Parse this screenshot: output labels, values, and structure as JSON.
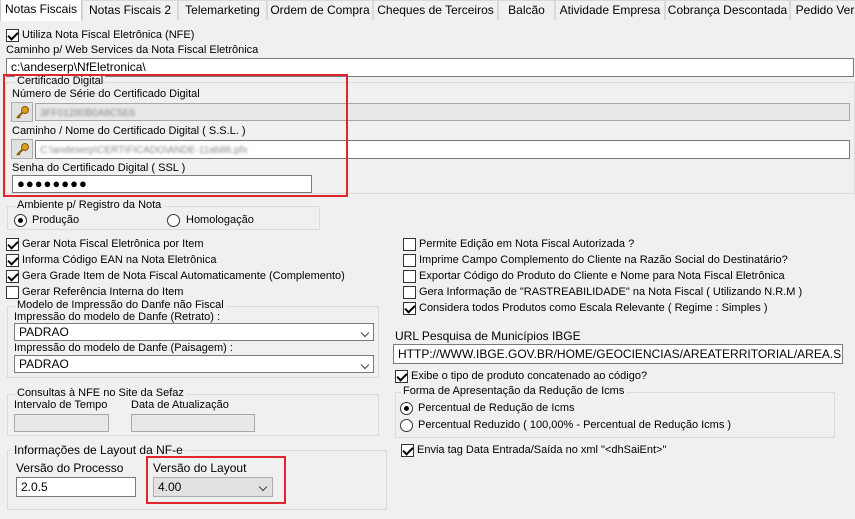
{
  "tabs": [
    "Notas Fiscais",
    "Notas Fiscais 2",
    "Telemarketing",
    "Ordem de Compra",
    "Cheques de Terceiros",
    "Balcão",
    "Atividade Empresa",
    "Cobrança Descontada",
    "Pedido Ver"
  ],
  "use_nfe": {
    "label": "Utiliza Nota Fiscal Eletrônica (NFE)",
    "checked": true
  },
  "ws_path": {
    "label": "Caminho p/ Web Services da Nota Fiscal Eletrônica",
    "value": "c:\\andeserp\\NfEletronica\\"
  },
  "certificate": {
    "legend": "Certificado Digital",
    "serial_label": "Número de Série do Certificado Digital",
    "serial_value": "3FF01280B0A8C5E6",
    "path_label": "Caminho / Nome do Certificado Digital ( S.S.L. )",
    "path_value": "C:\\andeserp\\CERTIFICADO\\ANDE-11ab86.pfx",
    "password_label": "Senha do Certificado Digital ( SSL )",
    "password_value": "●●●●●●●●"
  },
  "environment": {
    "legend": "Ambiente p/ Registro da Nota",
    "option1": "Produção",
    "option2": "Homologação",
    "selected": "Produção"
  },
  "left_checks": [
    {
      "label": "Gerar Nota Fiscal Eletrônica por Item",
      "checked": true
    },
    {
      "label": "Informa Código EAN na Nota Eletrônica",
      "checked": true
    },
    {
      "label": "Gera Grade Item de Nota Fiscal Automaticamente (Complemento)",
      "checked": true
    },
    {
      "label": "Gerar Referência Interna do Item",
      "checked": false
    }
  ],
  "right_checks": [
    {
      "label": "Permite Edição em Nota Fiscal Autorizada ?",
      "checked": false
    },
    {
      "label": "Imprime Campo Complemento do Cliente na Razão Social do Destinatário?",
      "checked": false
    },
    {
      "label": "Exportar Código do Produto do Cliente e Nome para Nota Fiscal Eletrônica",
      "checked": false
    },
    {
      "label": "Gera Informação de \"RASTREABILIDADE\" na Nota Fiscal  ( Utilizando N.R.M )",
      "checked": false
    },
    {
      "label": "Considera todos Produtos como Escala Relevante ( Regime : Simples )",
      "checked": true
    }
  ],
  "danfe": {
    "legend": "Modelo de Impressão do Danfe não Fiscal",
    "portrait_label": "Impressão do modelo de Danfe (Retrato) :",
    "portrait_value": "PADRAO",
    "landscape_label": "Impressão do modelo de Danfe (Paisagem) :",
    "landscape_value": "PADRAO"
  },
  "ibge": {
    "label": "URL Pesquisa de Municípios IBGE",
    "value": "HTTP://WWW.IBGE.GOV.BR/HOME/GEOCIENCIAS/AREATERRITORIAL/AREA.SHTM"
  },
  "show_product_type": {
    "label": "Exibe o tipo de produto concatenado ao código?",
    "checked": true
  },
  "sefaz": {
    "legend": "Consultas à NFE no Site da Sefaz",
    "interval_label": "Intervalo de Tempo",
    "update_label": "Data de Atualização"
  },
  "reduction": {
    "legend": "Forma de Apresentação da Redução de Icms",
    "option1": "Percentual de Redução de Icms",
    "option2": "Percentual Reduzido ( 100,00% - Percentual de Redução Icms )",
    "selected": "Percentual de Redução de Icms"
  },
  "layout_info": {
    "legend": "Informações de Layout da NF-e",
    "process_label": "Versão do Processo",
    "process_value": "2.0.5",
    "layout_label": "Versão do Layout",
    "layout_value": "4.00"
  },
  "send_tag": {
    "label": "Envia tag Data Entrada/Saída no xml \"<dhSaiEnt>\"",
    "checked": true
  },
  "colors": {
    "highlight": "#e0252f",
    "background": "#f0f0f0"
  }
}
